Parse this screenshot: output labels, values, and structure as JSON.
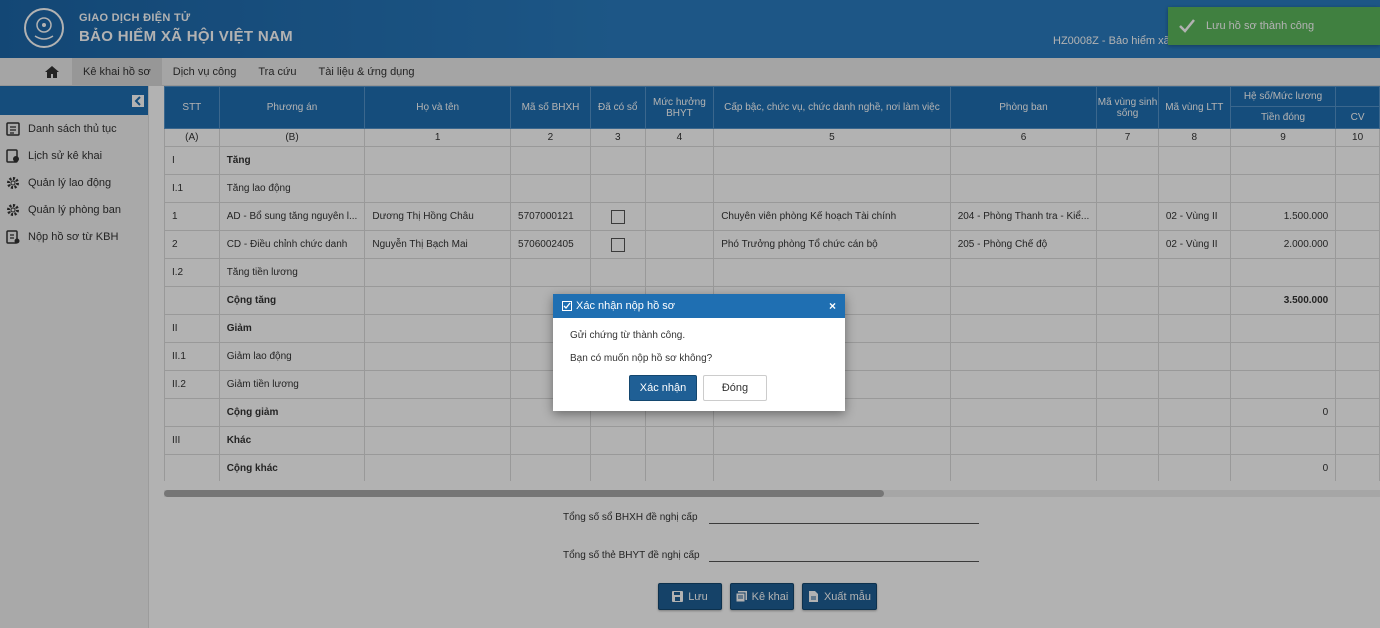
{
  "header": {
    "logo_line1": "GIAO DỊCH ĐIỆN TỬ",
    "logo_line2": "BẢO HIỂM XÃ HỘI VIỆT NAM",
    "user_info": "HZ0008Z - Bảo hiểm xã h"
  },
  "toast": {
    "message": "Lưu hồ sơ thành công"
  },
  "menu": {
    "items": [
      {
        "label": "Kê khai hồ sơ"
      },
      {
        "label": "Dịch vụ công"
      },
      {
        "label": "Tra cứu"
      },
      {
        "label": "Tài liệu & ứng dụng"
      }
    ]
  },
  "sidebar": {
    "items": [
      {
        "label": "Danh sách thủ tục",
        "icon": "list-icon"
      },
      {
        "label": "Lịch sử kê khai",
        "icon": "history-icon"
      },
      {
        "label": "Quản lý lao động",
        "icon": "gear-icon"
      },
      {
        "label": "Quản lý phòng ban",
        "icon": "gear-icon"
      },
      {
        "label": "Nộp hồ sơ từ KBH",
        "icon": "document-icon"
      }
    ]
  },
  "table": {
    "headers": {
      "stt": "STT",
      "phuong_an": "Phương án",
      "ho_ten": "Họ và tên",
      "ma_so": "Mã số BHXH",
      "da_co_so": "Đã có sổ",
      "muc_huong": "Mức hưởng BHYT",
      "cap_bac": "Cấp bậc, chức vụ, chức danh nghề, nơi làm việc",
      "phong_ban": "Phòng ban",
      "ma_vung_ss": "Mã vùng sinh sống",
      "ma_vung_ltt": "Mã vùng LTT",
      "he_so": "Hệ số/Mức lương",
      "tien_dong": "Tiền đóng",
      "cv": "CV"
    },
    "index_row": [
      "(A)",
      "(B)",
      "1",
      "2",
      "3",
      "4",
      "5",
      "6",
      "7",
      "8",
      "9",
      "10"
    ],
    "rows": [
      {
        "stt": "I",
        "pa": "Tăng",
        "bold": true
      },
      {
        "stt": "I.1",
        "pa": "Tăng lao động"
      },
      {
        "stt": "1",
        "pa": "AD - Bổ sung tăng nguyên l...",
        "name": "Dương Thị Hồng Châu",
        "ma": "5707000121",
        "chk": true,
        "cap": "Chuyên viên phòng Kế hoạch Tài chính",
        "pb": "204 - Phòng Thanh tra - Kiể...",
        "ltt": "02 - Vùng II",
        "td": "1.500.000"
      },
      {
        "stt": "2",
        "pa": "CD - Điều chỉnh chức danh",
        "name": "Nguyễn Thị Bạch Mai",
        "ma": "5706002405",
        "chk": true,
        "cap": "Phó Trưởng phòng Tổ chức cán bộ",
        "pb": "205 - Phòng Chế độ",
        "ltt": "02 - Vùng II",
        "td": "2.000.000"
      },
      {
        "stt": "I.2",
        "pa": "Tăng tiền lương"
      },
      {
        "stt": "",
        "pa": "Cộng tăng",
        "bold": true,
        "td": "3.500.000",
        "tdbold": true
      },
      {
        "stt": "II",
        "pa": "Giảm",
        "bold": true
      },
      {
        "stt": "II.1",
        "pa": "Giảm lao động"
      },
      {
        "stt": "II.2",
        "pa": "Giảm tiền lương"
      },
      {
        "stt": "",
        "pa": "Cộng giảm",
        "bold": true,
        "td": "0"
      },
      {
        "stt": "III",
        "pa": "Khác",
        "bold": true
      },
      {
        "stt": "",
        "pa": "Cộng khác",
        "bold": true,
        "td": "0"
      }
    ]
  },
  "summary": {
    "bhxh_label": "Tổng số sổ BHXH đề nghị cấp",
    "bhyt_label": "Tổng số thẻ BHYT đề nghị cấp"
  },
  "buttons": {
    "save": "Lưu",
    "declare": "Kê khai",
    "export": "Xuất mẫu"
  },
  "modal": {
    "title": "Xác nhận nộp hồ sơ",
    "line1": "Gửi chứng từ thành công.",
    "line2": "Bạn có muốn nộp hồ sơ không?",
    "confirm": "Xác nhận",
    "close": "Đóng"
  },
  "colors": {
    "primary": "#1f6fb2",
    "toast": "#5cb85c",
    "button": "#1f5f95"
  }
}
